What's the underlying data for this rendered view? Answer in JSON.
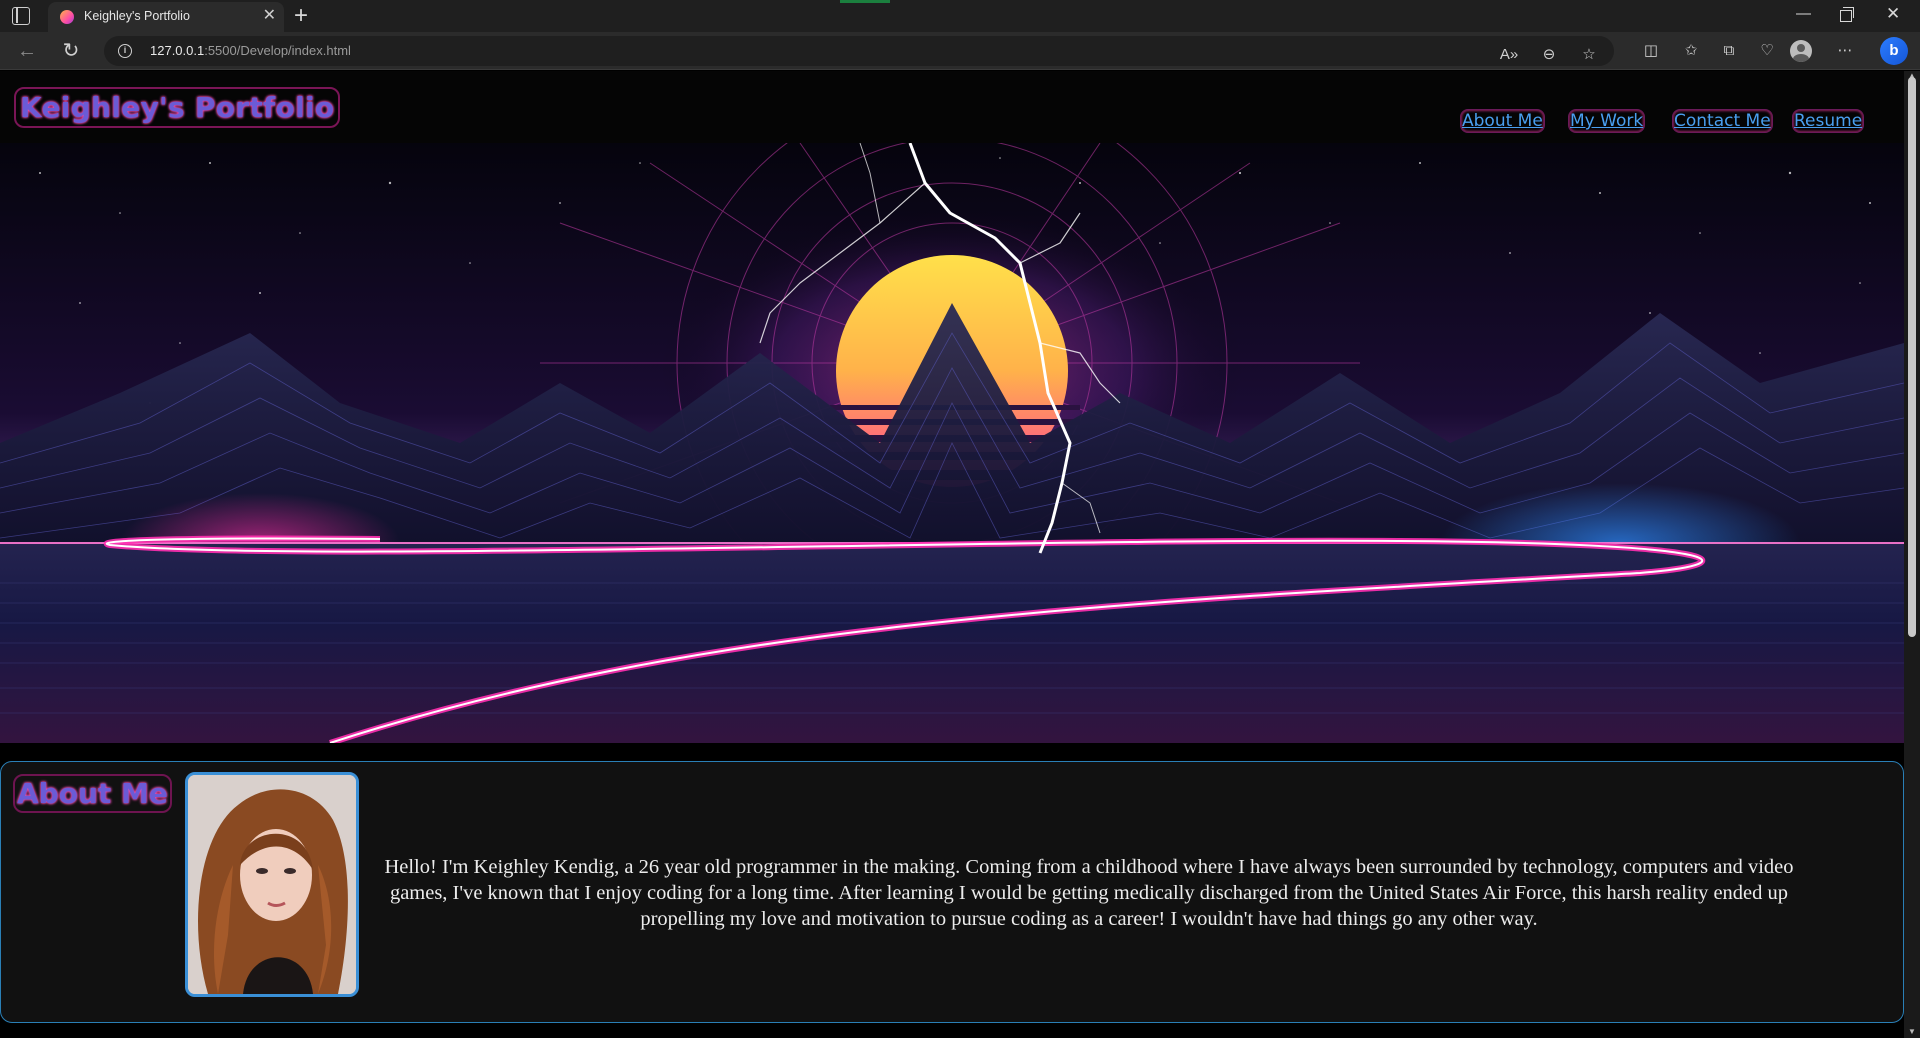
{
  "browser": {
    "tab_title": "Keighley's Portfolio",
    "tab_close": "✕",
    "new_tab": "+",
    "url_host": "127.0.0.1",
    "url_path": ":5500/Develop/index.html",
    "icons": [
      "tab-actions-icon",
      "back-arrow-icon",
      "reload-icon",
      "site-info-icon",
      "read-aloud-icon",
      "zoom-out-icon",
      "favorite-star-icon",
      "split-screen-icon",
      "favorites-icon",
      "collections-icon",
      "browser-essentials-icon",
      "profile-icon",
      "more-icon",
      "copilot-icon"
    ]
  },
  "site": {
    "title": "Keighley's Portfolio",
    "nav": {
      "about": "About Me",
      "work": "My Work",
      "contact": "Contact Me",
      "resume": "Resume"
    }
  },
  "about": {
    "heading": "About Me",
    "body": "Hello! I'm Keighley Kendig, a 26 year old programmer in the making. Coming from a childhood where I have always been surrounded by technology, computers and video games, I've known that I enjoy coding for a long time. After learning I would be getting medically discharged from the United States Air Force, this harsh reality ended up propelling my love and motivation to pursue coding as a career! I wouldn't have had things go any other way."
  },
  "colors": {
    "title_purple": "#6b5bd6",
    "neon_pink": "#ff4fb8",
    "nav_link_blue": "#4a9ff0",
    "about_border": "#2a7fb6"
  }
}
